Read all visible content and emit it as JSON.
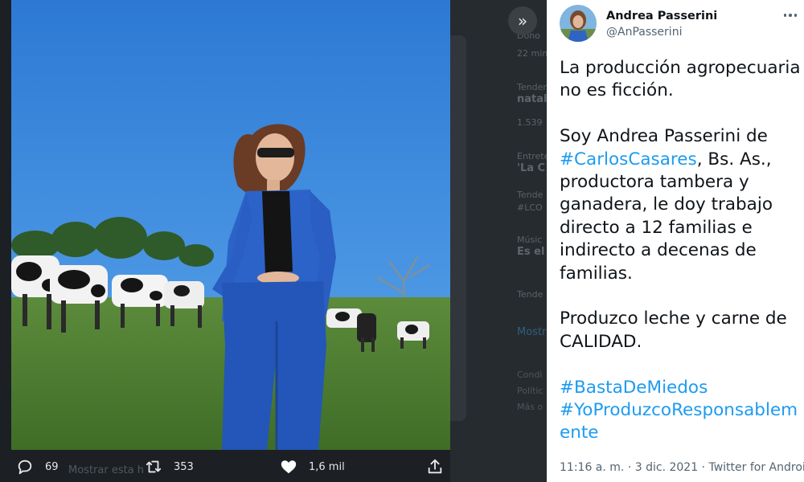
{
  "background": {
    "sidebar": [
      {
        "small": "Dono",
        "bold": ""
      },
      {
        "small": "22 min",
        "bold": ""
      },
      {
        "small": "Tenden",
        "bold": "natal"
      },
      {
        "small": "1.539",
        "bold": ""
      },
      {
        "small": "Entrete",
        "bold": "'La C"
      },
      {
        "small": "Tende",
        "bold": ""
      },
      {
        "small": "#LCO",
        "bold": ""
      },
      {
        "small": "Músic",
        "bold": "Es el"
      },
      {
        "small": "Tende",
        "bold": ""
      }
    ],
    "show_more": "Mostr",
    "footer": [
      "Condi",
      "Polític",
      "Más o"
    ],
    "bottom_text": "Mostrar esta h"
  },
  "lightbox": {
    "expand_icon": "chevron-double-right-icon",
    "actions": {
      "reply_count": "69",
      "retweet_count": "353",
      "like_count": "1,6 mil"
    }
  },
  "tweet": {
    "author": {
      "name": "Andrea Passerini",
      "handle": "@AnPasserini"
    },
    "body": {
      "p1": "La producción agropecuaria no es ficción.",
      "p2_a": "Soy Andrea Passerini de ",
      "p2_tag": "#CarlosCasares",
      "p2_b": ", Bs. As., productora tambera y ganadera, le doy trabajo directo a 12 familias e indirecto a decenas de familias.",
      "p3": "Produzco leche y carne de CALIDAD.",
      "tag1": "#BastaDeMiedos",
      "tag2": "#YoProduzcoResponsablemente"
    },
    "meta": {
      "time": "11:16 a. m.",
      "sep": " · ",
      "date": "3 dic. 2021",
      "source": "Twitter for Android"
    }
  },
  "colors": {
    "link": "#1d9bf0",
    "text": "#0f1419",
    "muted": "#536471",
    "sky": "#2f7fd6",
    "jeans": "#2356b8"
  }
}
